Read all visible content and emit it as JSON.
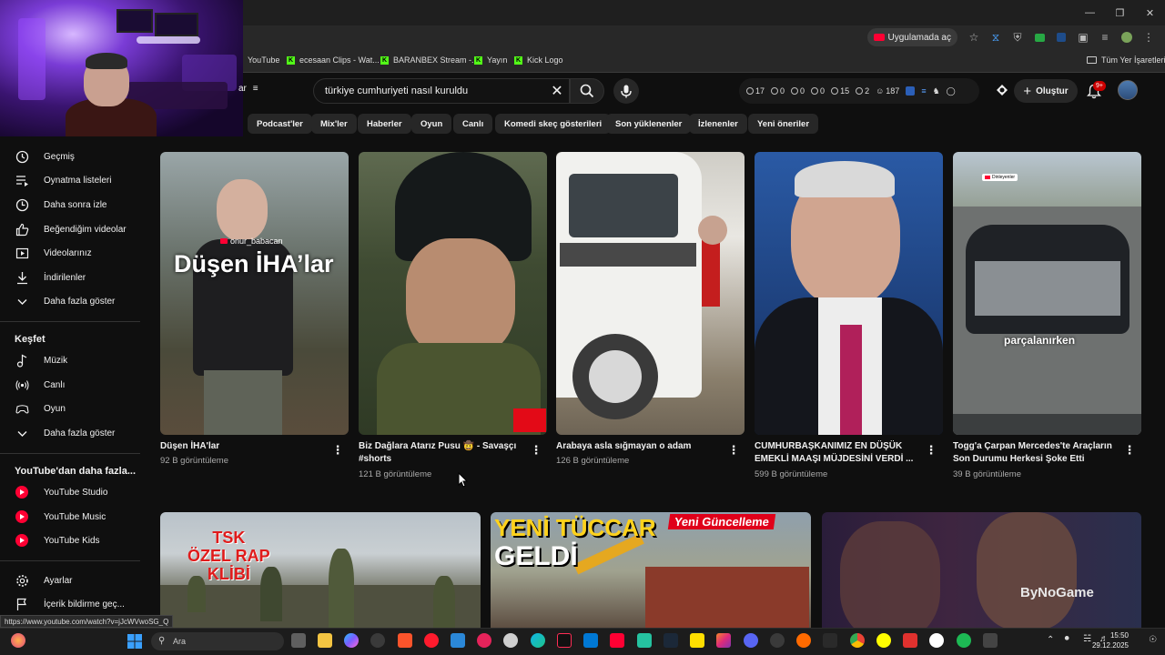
{
  "browser": {
    "app_pill": "Uygulamada aç",
    "bookmarks": [
      {
        "label": "YouTube",
        "icon": "youtube-icon"
      },
      {
        "label": "ecesaan Clips - Wat...",
        "icon": "kick-icon"
      },
      {
        "label": "BARANBEX Stream -...",
        "icon": "kick-icon"
      },
      {
        "label": "Yayın",
        "icon": "kick-icon"
      },
      {
        "label": "Kick Logo",
        "icon": "kick-icon"
      }
    ],
    "all_bookmarks": "Tüm Yer İşaretleri"
  },
  "masthead": {
    "filter_label": "ar",
    "search_value": "türkiye cumhuriyeti nasıl kuruldu",
    "stats": [
      "17",
      "0",
      "0",
      "0",
      "15",
      "2",
      "187"
    ],
    "create_label": "Oluştur",
    "notif_count": "9+"
  },
  "chips": [
    "Podcast'ler",
    "Mix'ler",
    "Haberler",
    "Oyun",
    "Canlı",
    "Komedi skeç gösterileri",
    "Son yüklenenler",
    "İzlenenler",
    "Yeni öneriler"
  ],
  "sidebar": {
    "you_items": [
      {
        "label": "Geçmiş",
        "icon": "history-icon"
      },
      {
        "label": "Oynatma listeleri",
        "icon": "playlist-icon"
      },
      {
        "label": "Daha sonra izle",
        "icon": "clock-icon"
      },
      {
        "label": "Beğendiğim videolar",
        "icon": "thumbs-up-icon"
      },
      {
        "label": "Videolarınız",
        "icon": "video-icon"
      },
      {
        "label": "İndirilenler",
        "icon": "download-icon"
      },
      {
        "label": "Daha fazla göster",
        "icon": "chevron-down-icon"
      }
    ],
    "explore_heading": "Keşfet",
    "explore_items": [
      {
        "label": "Müzik",
        "icon": "music-icon"
      },
      {
        "label": "Canlı",
        "icon": "live-icon"
      },
      {
        "label": "Oyun",
        "icon": "gamepad-icon"
      },
      {
        "label": "Daha fazla göster",
        "icon": "chevron-down-icon"
      }
    ],
    "more_heading": "YouTube'dan daha fazla...",
    "more_items": [
      {
        "label": "YouTube Studio"
      },
      {
        "label": "YouTube Music"
      },
      {
        "label": "YouTube Kids"
      }
    ],
    "settings": "Ayarlar",
    "report": "İçerik bildirme geç..."
  },
  "videos": [
    {
      "title": "Düşen İHA'lar",
      "views": "92 B görüntüleme",
      "overlay": "Düşen İHA’lar",
      "channel_tag": "onur_babacan"
    },
    {
      "title": "Biz Dağlara Atarız Pusu 🤠 - Savaşçı #shorts",
      "views": "121 B görüntüleme"
    },
    {
      "title": "Arabaya asla sığmayan o adam",
      "views": "126 B görüntüleme"
    },
    {
      "title": "CUMHURBAŞKANIMIZ EN DÜŞÜK EMEKLİ MAAŞI MÜJDESİNİ VERDİ ...",
      "views": "599 B görüntüleme"
    },
    {
      "title": "Togg'a Çarpan Mercedes'te Araçların Son Durumu Herkesi Şoke Etti",
      "views": "39 B görüntüleme",
      "overlay": "parçalanırken",
      "tag": "Dinleyenler"
    }
  ],
  "row2": {
    "tsk_text": [
      "TSK",
      "ÖZEL RAP",
      "KLİBİ"
    ],
    "tuccar_line1": "YENİ TÜCCAR",
    "tuccar_line2": "GELDİ",
    "tuccar_badge": "Yeni Güncelleme",
    "bynogame": "ByNoGame"
  },
  "status_url": "https://www.youtube.com/watch?v=jJcWVwoSG_Q",
  "taskbar": {
    "search_placeholder": "Ara",
    "time": "15:50",
    "date": "29.12.2025"
  },
  "colors": {
    "accent": "#ff0033",
    "bg": "#0f0f0f",
    "chip": "#272727",
    "kick": "#53fc18"
  }
}
